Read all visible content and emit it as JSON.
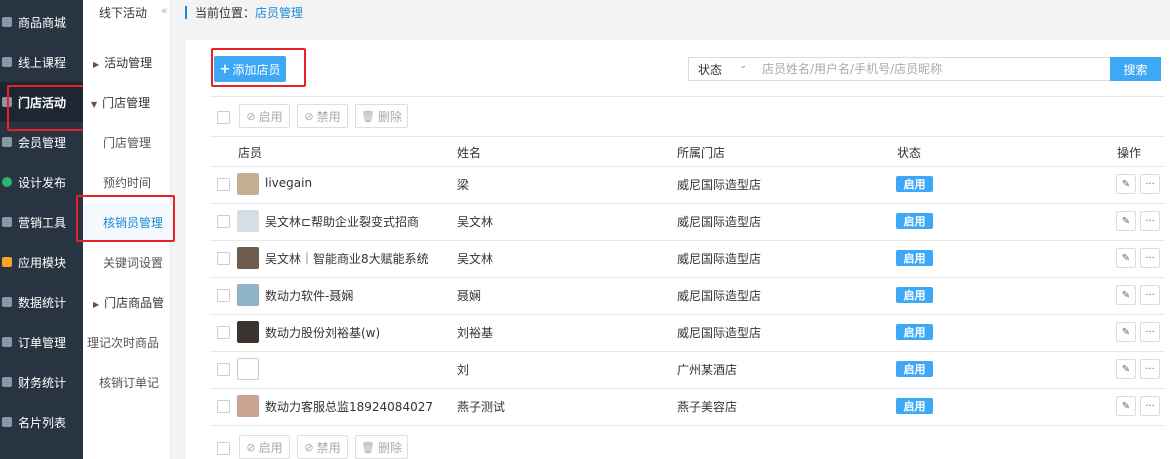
{
  "nav": {
    "items": [
      {
        "label": "商品商城",
        "icon": "shop-icon"
      },
      {
        "label": "线上课程",
        "icon": "search-course-icon"
      },
      {
        "label": "门店活动",
        "icon": "store-icon",
        "active": true
      },
      {
        "label": "会员管理",
        "icon": "member-icon"
      },
      {
        "label": "设计发布",
        "icon": "design-icon"
      },
      {
        "label": "营销工具",
        "icon": "marketing-icon"
      },
      {
        "label": "应用模块",
        "icon": "apps-icon"
      },
      {
        "label": "数据统计",
        "icon": "stats-icon"
      },
      {
        "label": "订单管理",
        "icon": "order-icon"
      },
      {
        "label": "财务统计",
        "icon": "finance-icon"
      },
      {
        "label": "名片列表",
        "icon": "card-icon"
      }
    ]
  },
  "subnav": {
    "title": "线下活动",
    "collapse_glyph": "«",
    "items": [
      {
        "label": "活动管理",
        "type": "group"
      },
      {
        "label": "门店管理",
        "type": "group-open"
      },
      {
        "label": "门店管理",
        "type": "item"
      },
      {
        "label": "预约时间",
        "type": "item"
      },
      {
        "label": "核销员管理",
        "type": "item",
        "active": true
      },
      {
        "label": "关键词设置",
        "type": "item"
      },
      {
        "label": "门店商品管",
        "type": "group"
      },
      {
        "label": "理记次时商品",
        "type": "item"
      },
      {
        "label": "核销订单记",
        "type": "item"
      }
    ]
  },
  "breadcrumb": {
    "prefix": "当前位置：",
    "current": "店员管理"
  },
  "toolbar": {
    "add_label": "添加店员",
    "status_select": "状态",
    "search_placeholder": "店员姓名/用户名/手机号/店员昵称",
    "search_label": "搜索"
  },
  "bulk": {
    "enable": "启用",
    "disable": "禁用",
    "delete": "删除"
  },
  "table": {
    "headers": {
      "clerk": "店员",
      "name": "姓名",
      "store": "所属门店",
      "status": "状态",
      "ops": "操作"
    },
    "rows": [
      {
        "clerk": "livegain",
        "name": "梁",
        "store": "威尼国际造型店",
        "status": "启用",
        "avatar": "#c7b092"
      },
      {
        "clerk": "吴文林⊏帮助企业裂变式招商",
        "name": "吴文林",
        "store": "威尼国际造型店",
        "status": "启用",
        "avatar": "#d5dde6"
      },
      {
        "clerk": "吴文林｜智能商业8大赋能系统",
        "name": "吴文林",
        "store": "威尼国际造型店",
        "status": "启用",
        "avatar": "#6d5b4c"
      },
      {
        "clerk": "数动力软件-聂娴",
        "name": "聂娴",
        "store": "威尼国际造型店",
        "status": "启用",
        "avatar": "#8fb4c9"
      },
      {
        "clerk": "数动力股份刘裕基(w)",
        "name": "刘裕基",
        "store": "威尼国际造型店",
        "status": "启用",
        "avatar": "#3b3330"
      },
      {
        "clerk": "",
        "name": "刘",
        "store": "广州某酒店",
        "status": "启用",
        "avatar": "#ffffff"
      },
      {
        "clerk": "数动力客服总监18924084027",
        "name": "燕子测试",
        "store": "燕子美容店",
        "status": "启用",
        "avatar": "#c9a591"
      }
    ]
  },
  "colors": {
    "accent": "#3da8f5",
    "highlight_box": "#e8202a",
    "sidebar_bg": "#283441"
  }
}
